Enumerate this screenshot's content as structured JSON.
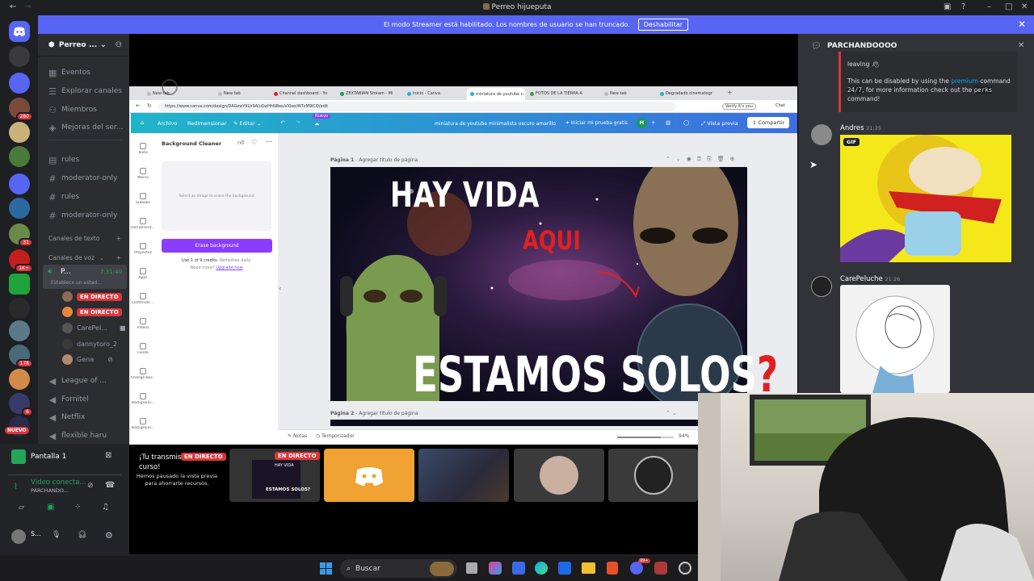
{
  "window": {
    "title": "Perreo hijueputa"
  },
  "banner": {
    "text": "El modo Streamer está habilitado. Los nombres de usuario se han truncado.",
    "button": "Deshabilitar"
  },
  "guild_badges": {
    "g1": "280",
    "g2": "31",
    "g3": "1K+",
    "g4": "178",
    "g5": "6",
    "new_label": "NUEVO"
  },
  "server": {
    "name": "Perreo ..."
  },
  "channels": {
    "eventos": "Eventos",
    "explorar": "Explorar canales",
    "miembros": "Miembros",
    "mejoras": "Mejoras del ser...",
    "c1": "rules",
    "c2": "moderator-only",
    "c3": "rules",
    "c4": "moderator-only",
    "text_cat": "Canales de texto",
    "voice_cat": "Canales de voz",
    "voice_main": "P...",
    "voice_timer": "7:31:40",
    "voice_status": "Establece un estad...",
    "live1": "EN DIRECTO",
    "live2": "EN DIRECTO",
    "u3": "CarePel...",
    "u4": "dannytoro_2",
    "u5": "Gena",
    "v2": "League of ...",
    "v3": "Fornitel",
    "v4": "Netflix",
    "v5": "flexible haru"
  },
  "panel": {
    "screen_label": "Pantalla 1",
    "video_status": "Vídeo conecta...",
    "video_sub": "PARCHANDO...",
    "user": "S..."
  },
  "browser": {
    "tabs": [
      "New tab",
      "New tab",
      "Channel dashboard - Yo",
      "ZEXTABIAN Stream - Mi",
      "Inicio - Canva",
      "miniatura de youtube n",
      "FOTOS DE LA TIERRA A",
      "New tab",
      "Degradado cinematogr"
    ],
    "url": "https://www.canva.com/design/DAGzwY9Lh9A/u5wHhN8wuVXkecW7cM9lCQ/edit",
    "verify": "Verify it's you",
    "chat": "Chat"
  },
  "canva": {
    "archivo": "Archivo",
    "redimensionar": "Redimensionar",
    "editar": "Editar",
    "nuevo": "Nuevo",
    "doc_title": "miniatura de youtube minimalista oscuro amarillo",
    "trial": "Iniciar mi prueba gratis",
    "avatar": "H",
    "preview": "Vista previa",
    "share": "Compartir",
    "rail": [
      "Texto",
      "Marca",
      "Subidos",
      "Herramient...",
      "Proyectos",
      "Apps",
      "Contenido ...",
      "Videos",
      "Fondo",
      "Change Bac...",
      "Backgroun...",
      "Backgroun..."
    ],
    "panel_title": "Background Cleaner",
    "panel_hint": "Select an image to erase the background",
    "erase_btn": "Erase background",
    "credits": "Use 1 of 9 credits.",
    "credits_refresh": "Refreshes daily.",
    "need_more": "Need more?",
    "upgrade": "Upgrade now",
    "page1": "Página 1",
    "page1_hint": "- Agregar título de página",
    "page2": "Página 2",
    "page2_hint": "- Agregar título de página",
    "notas": "Notas",
    "temporizador": "Temporizador",
    "zoom": "94%",
    "thumb_line1": "HAY VIDA",
    "thumb_line2": "AQUI",
    "thumb_line3": "ESTAMOS SOLOS",
    "thumb_q": "?"
  },
  "streams": {
    "paused_title": "¡Tu transmisión está en curso!",
    "paused_body": "Hemos pausado la vista previa para ahorrarte recursos.",
    "live_badge": "EN DIRECTO",
    "live_badge2": "EN DIRECTO",
    "mini_text1": "HAY VIDA",
    "mini_text2": "ESTAMOS SOLOS?"
  },
  "chat": {
    "channel": "PARCHANDOOOO",
    "bot_line1": "leaving",
    "bot_line2a": "This can be disabled by using the",
    "bot_premium": "premium",
    "bot_line2b": "command",
    "bot_line3a": "24/7",
    "bot_line3b": ", for more information check out the",
    "bot_perks": "perks",
    "bot_line4": "command!",
    "m1_user": "Andres",
    "m1_time": "21:25",
    "gif_label": "GIF",
    "m2_user": "CarePeluche",
    "m2_time": "21:26"
  },
  "taskbar": {
    "search": "Buscar",
    "badge": "99+"
  },
  "colors": {
    "blurple": "#5865f2",
    "live_red": "#da373c",
    "canva_purple": "#8b3dff",
    "stream_orange": "#f0a232"
  }
}
